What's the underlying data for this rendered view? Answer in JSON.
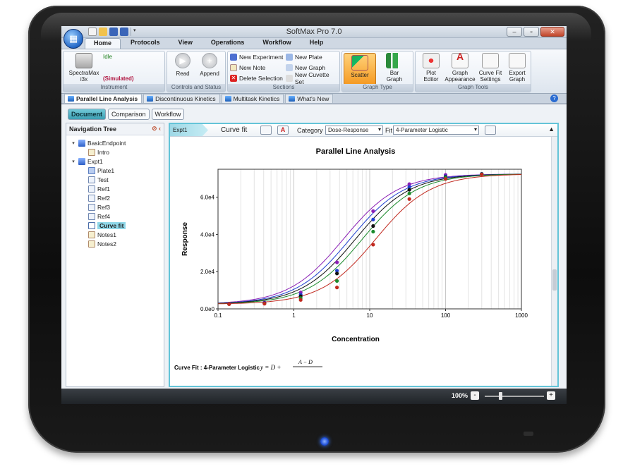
{
  "window": {
    "title": "SoftMax Pro 7.0"
  },
  "ribbon_tabs": [
    "Home",
    "Protocols",
    "View",
    "Operations",
    "Workflow",
    "Help"
  ],
  "ribbon": {
    "instrument": {
      "device_line1": "SpectraMax",
      "device_line2": "i3x",
      "status": "Idle",
      "mode": "(Simulated)",
      "group_label": "Instrument"
    },
    "controls": {
      "read": "Read",
      "append": "Append",
      "group_label": "Controls and Status"
    },
    "sections": {
      "new_experiment": "New Experiment",
      "new_note": "New Note",
      "delete_selection": "Delete Selection",
      "new_plate": "New Plate",
      "new_graph": "New Graph",
      "new_cuvette_set": "New Cuvette Set",
      "group_label": "Sections"
    },
    "graph_type": {
      "scatter": "Scatter",
      "bar_line1": "Bar",
      "bar_line2": "Graph",
      "group_label": "Graph Type"
    },
    "graph_tools": {
      "plot_l1": "Plot",
      "plot_l2": "Editor",
      "appearance_l1": "Graph",
      "appearance_l2": "Appearance",
      "curvefit_l1": "Curve Fit",
      "curvefit_l2": "Settings",
      "export_l1": "Export",
      "export_l2": "Graph",
      "group_label": "Graph Tools"
    }
  },
  "doc_tabs": [
    "Parallel Line Analysis",
    "Discontinuous Kinetics",
    "Multitask Kinetics",
    "What's New"
  ],
  "mode_tabs": [
    "Document",
    "Comparison",
    "Workflow"
  ],
  "nav": {
    "title": "Navigation Tree",
    "items": [
      {
        "label": "BasicEndpoint",
        "level": 0,
        "icon": "flask-icon",
        "expander": "▾"
      },
      {
        "label": "Intro",
        "level": 1,
        "icon": "note-icon"
      },
      {
        "label": "Expt1",
        "level": 0,
        "icon": "flask-icon",
        "expander": "▾"
      },
      {
        "label": "Plate1",
        "level": 1,
        "icon": "plate-icon"
      },
      {
        "label": "Test",
        "level": 1,
        "icon": "table-icon"
      },
      {
        "label": "Ref1",
        "level": 1,
        "icon": "table-icon"
      },
      {
        "label": "Ref2",
        "level": 1,
        "icon": "table-icon"
      },
      {
        "label": "Ref3",
        "level": 1,
        "icon": "table-icon"
      },
      {
        "label": "Ref4",
        "level": 1,
        "icon": "table-icon"
      },
      {
        "label": "Curve fit",
        "level": 1,
        "icon": "graph-icon",
        "selected": true
      },
      {
        "label": "Notes1",
        "level": 1,
        "icon": "note-icon"
      },
      {
        "label": "Notes2",
        "level": 1,
        "icon": "note-icon"
      }
    ]
  },
  "graph_section": {
    "tag": "Expt1",
    "title": "Curve fit",
    "category_label": "Category",
    "category_value": "Dose-Response",
    "fit_label": "Fit",
    "fit_value": "4-Parameter Logistic",
    "footer_text": "Curve Fit : 4-Parameter Logistic",
    "formula_start": "y = D +",
    "formula_numerator": "A − D"
  },
  "status": {
    "zoom": "100%",
    "minus": "-",
    "plus": "+"
  },
  "chart_data": {
    "type": "scatter",
    "title": "Parallel Line Analysis",
    "xlabel": "Concentration",
    "ylabel": "Response",
    "xscale": "log",
    "xlim": [
      0.1,
      1000
    ],
    "ylim": [
      0,
      75000
    ],
    "x_ticks": [
      "0.1",
      "1",
      "10",
      "100",
      "1000"
    ],
    "y_ticks": [
      "0.0e0",
      "2.0e4",
      "4.0e4",
      "6.0e4"
    ],
    "grid": "vertical",
    "legend": "none",
    "fit": {
      "A": 2500,
      "D": 72500,
      "B": 1.2
    },
    "series": [
      {
        "color": "#8a1fb5",
        "C": 4.5,
        "x": [
          0.14,
          0.41,
          1.23,
          3.7,
          11.1,
          33.3,
          100,
          300
        ],
        "y": [
          2800,
          3400,
          8800,
          25000,
          52500,
          67000,
          72000,
          72500
        ]
      },
      {
        "color": "#1f3fd0",
        "C": 5.5,
        "x": [
          0.14,
          0.41,
          1.23,
          3.7,
          11.1,
          33.3,
          100,
          300
        ],
        "y": [
          2700,
          3100,
          7600,
          20500,
          48000,
          65500,
          71200,
          72500
        ]
      },
      {
        "color": "#111111",
        "C": 6.5,
        "x": [
          0.14,
          0.41,
          1.23,
          3.7,
          11.1,
          33.3,
          100,
          300
        ],
        "y": [
          2650,
          3000,
          6800,
          19000,
          44500,
          64000,
          70800,
          72400
        ]
      },
      {
        "color": "#1b8a2c",
        "C": 8.0,
        "x": [
          0.14,
          0.41,
          1.23,
          3.7,
          11.1,
          33.3,
          100,
          300
        ],
        "y": [
          2600,
          2900,
          5800,
          15000,
          41500,
          62000,
          70500,
          72300
        ]
      },
      {
        "color": "#c1291f",
        "C": 12.0,
        "x": [
          0.14,
          0.41,
          1.23,
          3.7,
          11.1,
          33.3,
          100,
          300
        ],
        "y": [
          2550,
          2800,
          4800,
          11500,
          34500,
          59000,
          69800,
          72200
        ]
      }
    ]
  },
  "colors": {
    "accent_teal": "#64c4d8",
    "selected_orange": "#f59a22",
    "status_idle": "#1d7f1d",
    "status_simulated": "#b0123e"
  }
}
